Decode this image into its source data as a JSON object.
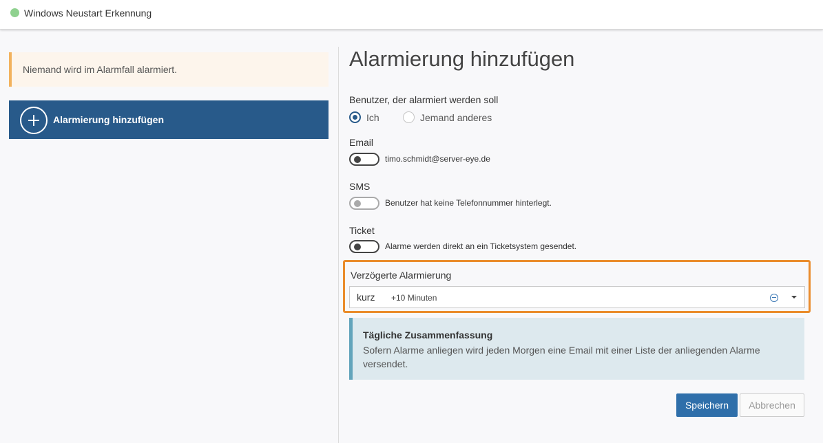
{
  "header": {
    "title": "Windows Neustart Erkennung",
    "status_color": "#8fd18f"
  },
  "sidebar": {
    "warning_text": "Niemand wird im Alarmfall alarmiert.",
    "add_button_label": "Alarmierung hinzufügen",
    "add_button_icon": "plus-circle-icon"
  },
  "form": {
    "title": "Alarmierung hinzufügen",
    "user_section_label": "Benutzer, der alarmiert werden soll",
    "user_options": [
      "Ich",
      "Jemand anderes"
    ],
    "user_selected": "Ich",
    "email": {
      "label": "Email",
      "description": "timo.schmidt@server-eye.de",
      "enabled": false
    },
    "sms": {
      "label": "SMS",
      "description": "Benutzer hat keine Telefonnummer hinterlegt.",
      "enabled": false,
      "disabled": true
    },
    "ticket": {
      "label": "Ticket",
      "description": "Alarme werden direkt an ein Ticketsystem gesendet.",
      "enabled": false
    },
    "delay": {
      "label": "Verzögerte Alarmierung",
      "selected_value": "kurz",
      "selected_hint": "+10 Minuten"
    },
    "summary": {
      "title": "Tägliche Zusammenfassung",
      "text": "Sofern Alarme anliegen wird jeden Morgen eine Email mit einer Liste der anliegenden Alarme versendet."
    },
    "save_label": "Speichern",
    "cancel_label": "Abbrechen"
  },
  "colors": {
    "primary": "#285a8a",
    "button_primary": "#2f6faa",
    "warning_border": "#f2b25e",
    "highlight_border": "#ea8c2c",
    "info_border": "#62a4bb"
  }
}
